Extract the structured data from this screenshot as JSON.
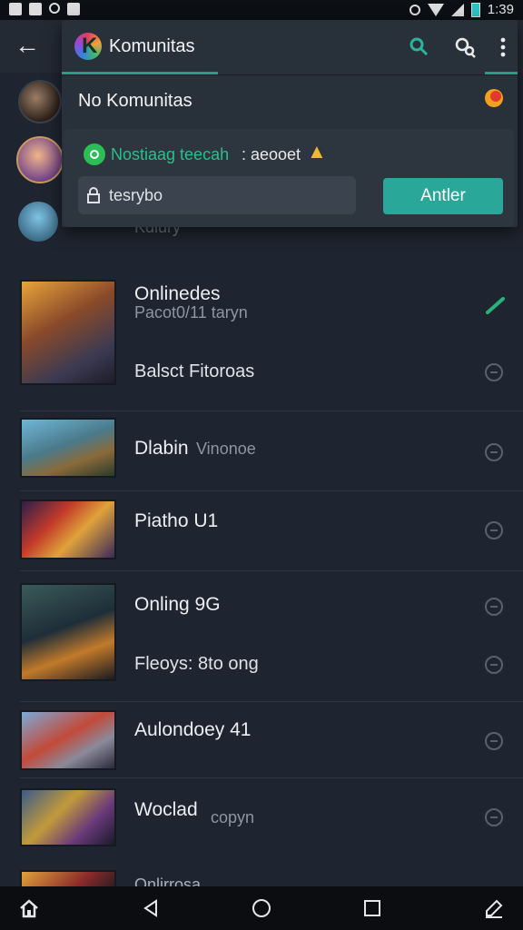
{
  "status_bar": {
    "time": "1:39"
  },
  "popup": {
    "app_title": "Komunitas",
    "row_label": "No Komunitas",
    "message_highlight": "Nostiaag teecah",
    "message_rest": ": aeooet",
    "input_value": "tesrybo",
    "apply_label": "Antler"
  },
  "background_under_popup": "Kdiury",
  "items": [
    {
      "title": "Onlinedes",
      "subtitle": "Pacot0/11 taryn",
      "secondary": "Balsct Fitoroas",
      "action": "checked"
    },
    {
      "title": "Dlabin",
      "subtitle": "Vinonoe",
      "action": "add"
    },
    {
      "title": "Piatho U1",
      "action": "add"
    },
    {
      "title": "Onling 9G",
      "secondary": "Fleoys: 8to ong",
      "action": "add"
    },
    {
      "title": "Aulondoey 41",
      "action": "add"
    },
    {
      "title": "Woclad",
      "subtitle": "copyn",
      "action": "add"
    },
    {
      "title": "Onlirrosa"
    }
  ],
  "colors": {
    "accent": "#29a89a",
    "background": "#1f2530",
    "popup": "#283039"
  }
}
